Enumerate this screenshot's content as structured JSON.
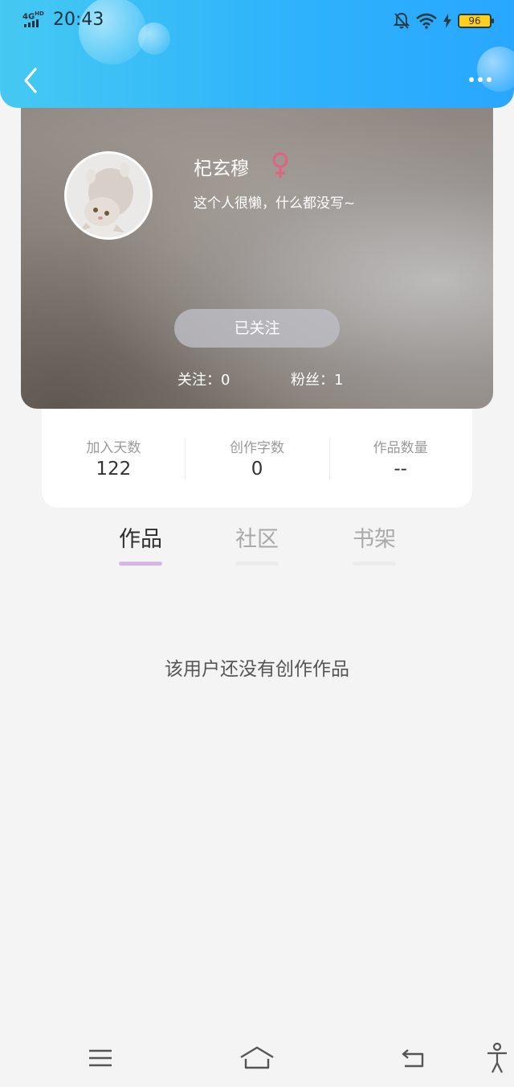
{
  "status_bar": {
    "network": "4G",
    "hd": "HD",
    "time": "20:43",
    "battery": "96"
  },
  "header": {
    "back_icon": "chevron-left-icon",
    "more_icon": "more-dots-icon"
  },
  "profile": {
    "name": "杞玄穆",
    "gender_icon": "female-icon",
    "bio": "这个人很懒，什么都没写~",
    "follow_button": "已关注",
    "following": "关注：0",
    "fans": "粉丝：1"
  },
  "stats": [
    {
      "label": "加入天数",
      "value": "122"
    },
    {
      "label": "创作字数",
      "value": "0"
    },
    {
      "label": "作品数量",
      "value": "--"
    }
  ],
  "tabs": [
    {
      "label": "作品",
      "active": true
    },
    {
      "label": "社区",
      "active": false
    },
    {
      "label": "书架",
      "active": false
    }
  ],
  "empty_message": "该用户还没有创作作品",
  "colors": {
    "header_start": "#45c9f2",
    "header_end": "#29a7ff",
    "tab_active_underline": "#d7b6e8",
    "gender_color": "#e0637f"
  },
  "system_nav": {
    "menu_icon": "menu-icon",
    "home_icon": "home-icon",
    "back_icon": "back-arrow-icon",
    "accessibility_icon": "accessibility-icon"
  }
}
